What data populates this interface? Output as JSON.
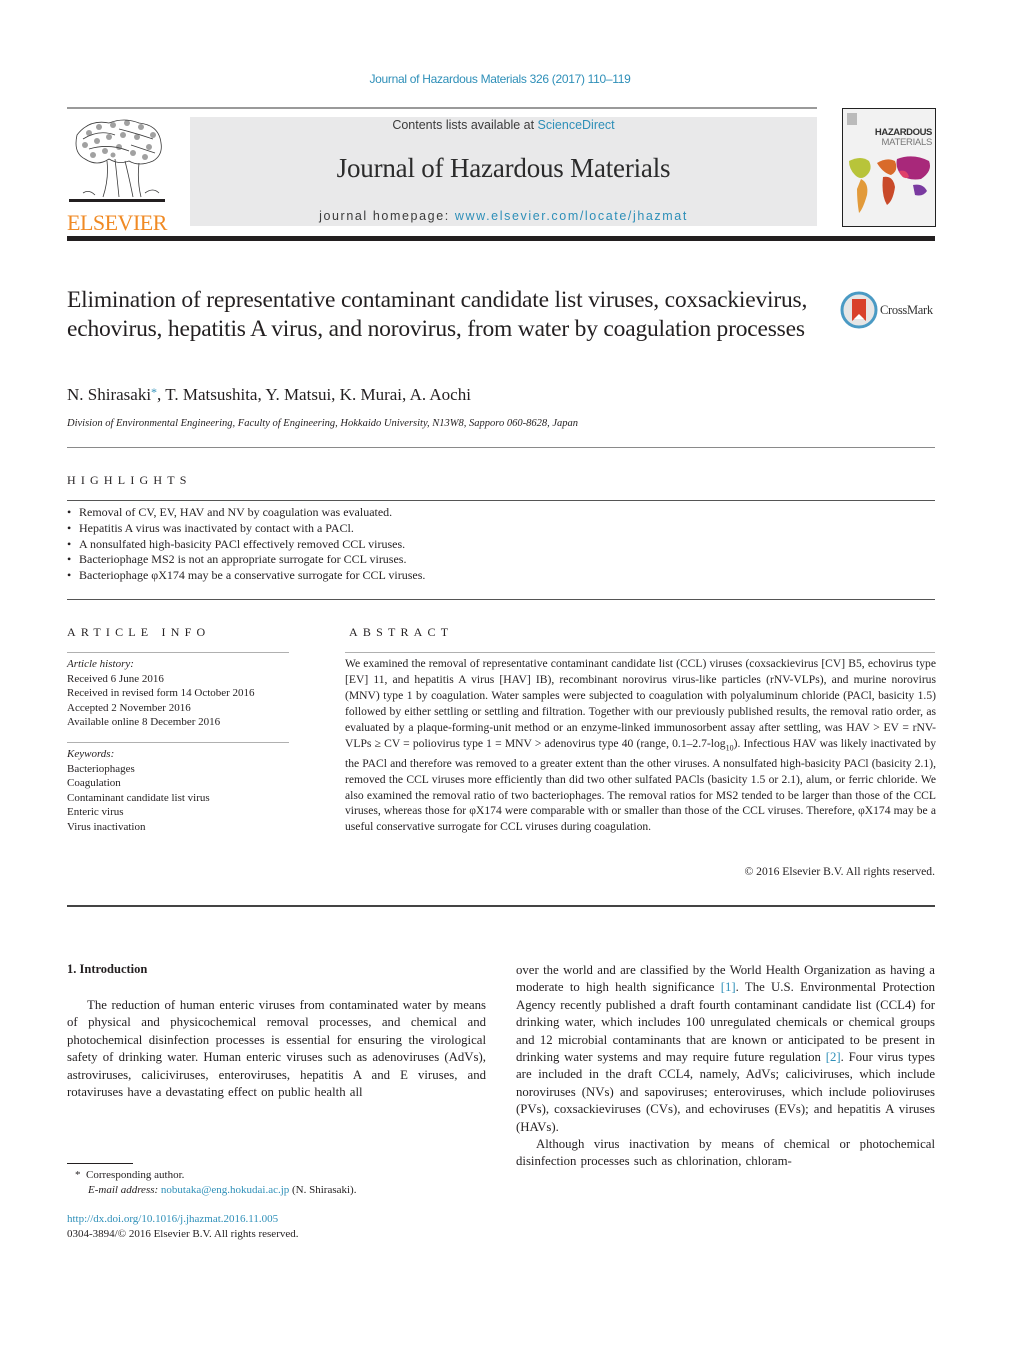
{
  "header": {
    "citation": "Journal of Hazardous Materials 326 (2017) 110–119",
    "contents_prefix": "Contents lists available at ",
    "contents_link": "ScienceDirect",
    "journal_name": "Journal of Hazardous Materials",
    "homepage_prefix": "journal homepage: ",
    "homepage_link": "www.elsevier.com/locate/jhazmat",
    "publisher_wordmark": "ELSEVIER",
    "cover": {
      "title_line1": "HAZARDOUS",
      "title_line2": "MATERIALS"
    },
    "crossmark_label": "CrossMark",
    "accent_color": "#2e8fb8",
    "publisher_color": "#f08a24"
  },
  "article": {
    "title": "Elimination of representative contaminant candidate list viruses, coxsackievirus, echovirus, hepatitis A virus, and norovirus, from water by coagulation processes",
    "authors": [
      "N. Shirasaki",
      "T. Matsushita",
      "Y. Matsui",
      "K. Murai",
      "A. Aochi"
    ],
    "corresponding_marker": "*",
    "affiliation": "Division of Environmental Engineering, Faculty of Engineering, Hokkaido University, N13W8, Sapporo 060-8628, Japan"
  },
  "highlights": {
    "heading": "HIGHLIGHTS",
    "items": [
      "Removal of CV, EV, HAV and NV by coagulation was evaluated.",
      "Hepatitis A virus was inactivated by contact with a PACl.",
      "A nonsulfated high-basicity PACl effectively removed CCL viruses.",
      "Bacteriophage MS2 is not an appropriate surrogate for CCL viruses.",
      "Bacteriophage φX174 may be a conservative surrogate for CCL viruses."
    ]
  },
  "article_info": {
    "heading": "ARTICLE INFO",
    "history_label": "Article history:",
    "history": [
      "Received 6 June 2016",
      "Received in revised form 14 October 2016",
      "Accepted 2 November 2016",
      "Available online 8 December 2016"
    ],
    "keywords_label": "Keywords:",
    "keywords": [
      "Bacteriophages",
      "Coagulation",
      "Contaminant candidate list virus",
      "Enteric virus",
      "Virus inactivation"
    ]
  },
  "abstract": {
    "heading": "ABSTRACT",
    "part1": "We examined the removal of representative contaminant candidate list (CCL) viruses (coxsackievirus [CV] B5, echovirus type [EV] 11, and hepatitis A virus [HAV] IB), recombinant norovirus virus-like particles (rNV-VLPs), and murine norovirus (MNV) type 1 by coagulation. Water samples were subjected to coagulation with polyaluminum chloride (PACl, basicity 1.5) followed by either settling or settling and filtration. Together with our previously published results, the removal ratio order, as evaluated by a plaque-forming-unit method or an enzyme-linked immunosorbent assay after settling, was HAV > EV = rNV-VLPs ≥ CV = poliovirus type 1 = MNV > adenovirus type 40 (range, 0.1–2.7-log",
    "subscript": "10",
    "part2": "). Infectious HAV was likely inactivated by the PACl and therefore was removed to a greater extent than the other viruses. A nonsulfated high-basicity PACl (basicity 2.1), removed the CCL viruses more efficiently than did two other sulfated PACls (basicity 1.5 or 2.1), alum, or ferric chloride. We also examined the removal ratio of two bacteriophages. The removal ratios for MS2 tended to be larger than those of the CCL viruses, whereas those for φX174 were comparable with or smaller than those of the CCL viruses. Therefore, φX174 may be a useful conservative surrogate for CCL viruses during coagulation.",
    "copyright": "© 2016 Elsevier B.V. All rights reserved."
  },
  "body": {
    "section_heading": "1.  Introduction",
    "left_para": "The reduction of human enteric viruses from contaminated water by means of physical and physicochemical removal processes, and chemical and photochemical disinfection processes is essential for ensuring the virological safety of drinking water. Human enteric viruses such as adenoviruses (AdVs), astroviruses, caliciviruses, enteroviruses, hepatitis A and E viruses, and rotaviruses have a devastating effect on public health all",
    "right_p1_a": "over the world and are classified by the World Health Organization as having a moderate to high health significance ",
    "ref1": "[1]",
    "right_p1_b": ". The U.S. Environmental Protection Agency recently published a draft fourth contaminant candidate list (CCL4) for drinking water, which includes 100 unregulated chemicals or chemical groups and 12 microbial contaminants that are known or anticipated to be present in drinking water systems and may require future regulation ",
    "ref2": "[2]",
    "right_p1_c": ". Four virus types are included in the draft CCL4, namely, AdVs; caliciviruses, which include noroviruses (NVs) and sapoviruses; enteroviruses, which include polioviruses (PVs), coxsackieviruses (CVs), and echoviruses (EVs); and hepatitis A viruses (HAVs).",
    "right_p2": "Although virus inactivation by means of chemical or photochemical disinfection processes such as chlorination, chloram-"
  },
  "footnotes": {
    "marker": "*",
    "corresponding": "Corresponding author.",
    "email_label": "E-mail address: ",
    "email": "nobutaka@eng.hokudai.ac.jp",
    "email_owner": " (N. Shirasaki).",
    "doi": "http://dx.doi.org/10.1016/j.jhazmat.2016.11.005",
    "issn_copyright": "0304-3894/© 2016 Elsevier B.V. All rights reserved."
  }
}
